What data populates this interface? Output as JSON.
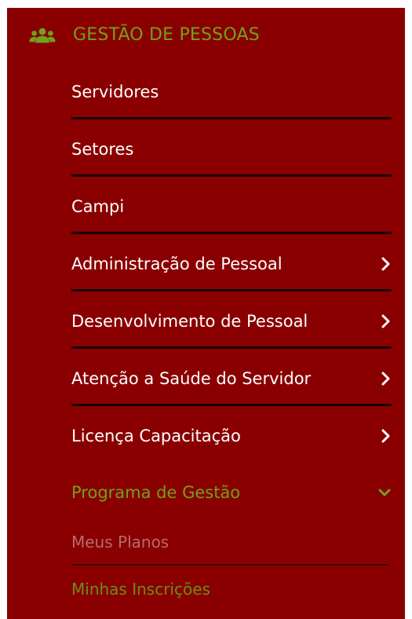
{
  "colors": {
    "panel_bg": "#8a0000",
    "accent": "#72a01f",
    "text": "#ffffff",
    "divider": "#1b0000",
    "muted_text": "#b56b6b"
  },
  "section": {
    "icon": "users-icon",
    "title": "GESTÃO DE PESSOAS"
  },
  "menu": {
    "items": [
      {
        "label": "Servidores"
      },
      {
        "label": "Setores"
      },
      {
        "label": "Campi"
      },
      {
        "label": "Administração de Pessoal",
        "icon": "chevron-right-icon"
      },
      {
        "label": "Desenvolvimento de Pessoal",
        "icon": "chevron-right-icon"
      },
      {
        "label": "Atenção a Saúde do Servidor",
        "icon": "chevron-right-icon"
      },
      {
        "label": "Licença Capacitação",
        "icon": "chevron-right-icon"
      },
      {
        "label": "Programa de Gestão",
        "icon": "chevron-down-icon",
        "expanded": true
      }
    ],
    "submenu": [
      {
        "label": "Meus Planos"
      },
      {
        "label": "Minhas Inscrições"
      }
    ]
  }
}
